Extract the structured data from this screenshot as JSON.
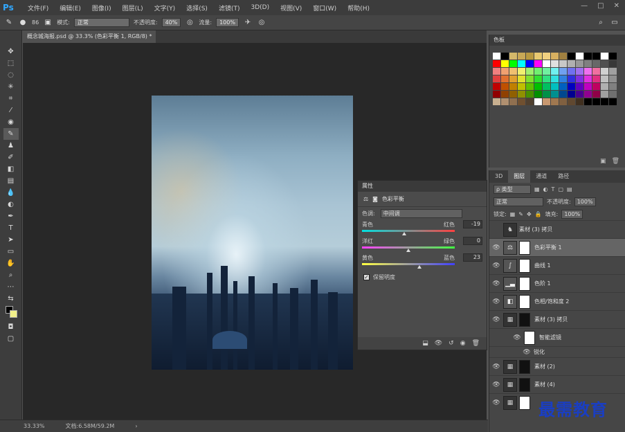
{
  "app": {
    "logo": "Ps",
    "menu": [
      "文件(F)",
      "编辑(E)",
      "图像(I)",
      "图层(L)",
      "文字(Y)",
      "选择(S)",
      "滤镜(T)",
      "3D(D)",
      "视图(V)",
      "窗口(W)",
      "帮助(H)"
    ],
    "window_controls": [
      "—",
      "□",
      "✕"
    ]
  },
  "options": {
    "brush_size": "86",
    "mode_label": "模式:",
    "mode_value": "正常",
    "opacity_label": "不透明度:",
    "opacity_value": "40%",
    "flow_label": "流量:",
    "flow_value": "100%"
  },
  "document": {
    "tab_title": "概念城海报.psd @ 33.3% (色彩平衡 1, RGB/8) *",
    "zoom": "33.33%",
    "doc_info": "文档:6.58M/59.2M"
  },
  "swatches": {
    "tab": "色板",
    "colors": [
      "#ffffff",
      "#000000",
      "#d4b86a",
      "#c8a856",
      "#b89840",
      "#e8c870",
      "#f0d080",
      "#d8b060",
      "#a08040",
      "#000000",
      "#ffffff",
      "#000000",
      "#000000",
      "#ffffff",
      "#000000",
      "#ff0000",
      "#ffff00",
      "#00ff00",
      "#00ffff",
      "#0000ff",
      "#ff00ff",
      "#ffffff",
      "#e0e0e0",
      "#c8c8c8",
      "#b0b0b0",
      "#989898",
      "#808080",
      "#686868",
      "#505050",
      "#383838",
      "#f08080",
      "#f0a070",
      "#f0c070",
      "#f0f070",
      "#a0f070",
      "#70f070",
      "#70f0a0",
      "#70f0f0",
      "#70a0f0",
      "#7070f0",
      "#a070f0",
      "#f070f0",
      "#f070a0",
      "#d0d0d0",
      "#a0a0a0",
      "#e04040",
      "#e07030",
      "#e0a030",
      "#e0e030",
      "#80e030",
      "#30e030",
      "#30e080",
      "#30e0e0",
      "#3080e0",
      "#3030e0",
      "#8030e0",
      "#e030e0",
      "#e03080",
      "#c0c0c0",
      "#909090",
      "#c00000",
      "#c05000",
      "#c08000",
      "#c0c000",
      "#60c000",
      "#00c000",
      "#00c060",
      "#00c0c0",
      "#0060c0",
      "#0000c0",
      "#6000c0",
      "#c000c0",
      "#c00060",
      "#b0b0b0",
      "#808080",
      "#900000",
      "#904000",
      "#906000",
      "#909000",
      "#489000",
      "#009000",
      "#009048",
      "#009090",
      "#004890",
      "#000090",
      "#480090",
      "#900090",
      "#900048",
      "#a0a0a0",
      "#707070",
      "#c8b090",
      "#b09070",
      "#907050",
      "#705030",
      "#504030",
      "#ffffff",
      "#c89870",
      "#a07850",
      "#806040",
      "#604830",
      "#403020",
      "#000000",
      "#000000",
      "#000000",
      "#000000"
    ]
  },
  "layers_panel": {
    "tabs": [
      "3D",
      "图层",
      "通道",
      "路径"
    ],
    "kind_label": "ρ 类型",
    "blend": "正常",
    "opacity_label": "不透明度:",
    "opacity": "100%",
    "lock_label": "锁定:",
    "fill_label": "填充:",
    "fill": "100%",
    "layers": [
      {
        "name": "素材 (3) 拷贝",
        "thumb": "dark"
      },
      {
        "name": "色彩平衡 1",
        "thumb": "adj",
        "selected": true
      },
      {
        "name": "曲线 1",
        "thumb": "adj"
      },
      {
        "name": "色阶 1",
        "thumb": "adj"
      },
      {
        "name": "色相/饱和度 2",
        "thumb": "adj"
      },
      {
        "name": "素材 (3) 拷贝",
        "thumb": "dark"
      },
      {
        "name": "智能滤镜",
        "thumb": "light"
      },
      {
        "name": "锐化",
        "thumb": "none"
      },
      {
        "name": "素材 (2)",
        "thumb": "dark"
      },
      {
        "name": "素材 (4)",
        "thumb": "dark"
      },
      {
        "name": "",
        "thumb": "dark"
      }
    ]
  },
  "properties": {
    "tab": "属性",
    "title": "色彩平衡",
    "tone_label": "色调:",
    "tone_value": "中间调",
    "sliders": [
      {
        "left": "青色",
        "right": "红色",
        "value": "-19",
        "pos": 0.45,
        "gradient": "linear-gradient(90deg,#00e0e0,#ff4040)"
      },
      {
        "left": "洋红",
        "right": "绿色",
        "value": "0",
        "pos": 0.5,
        "gradient": "linear-gradient(90deg,#ff40ff,#40ff40)"
      },
      {
        "left": "黄色",
        "right": "蓝色",
        "value": "23",
        "pos": 0.62,
        "gradient": "linear-gradient(90deg,#ffff40,#4040ff)"
      }
    ],
    "preserve_label": "保留明度"
  },
  "watermark": "最需教育"
}
